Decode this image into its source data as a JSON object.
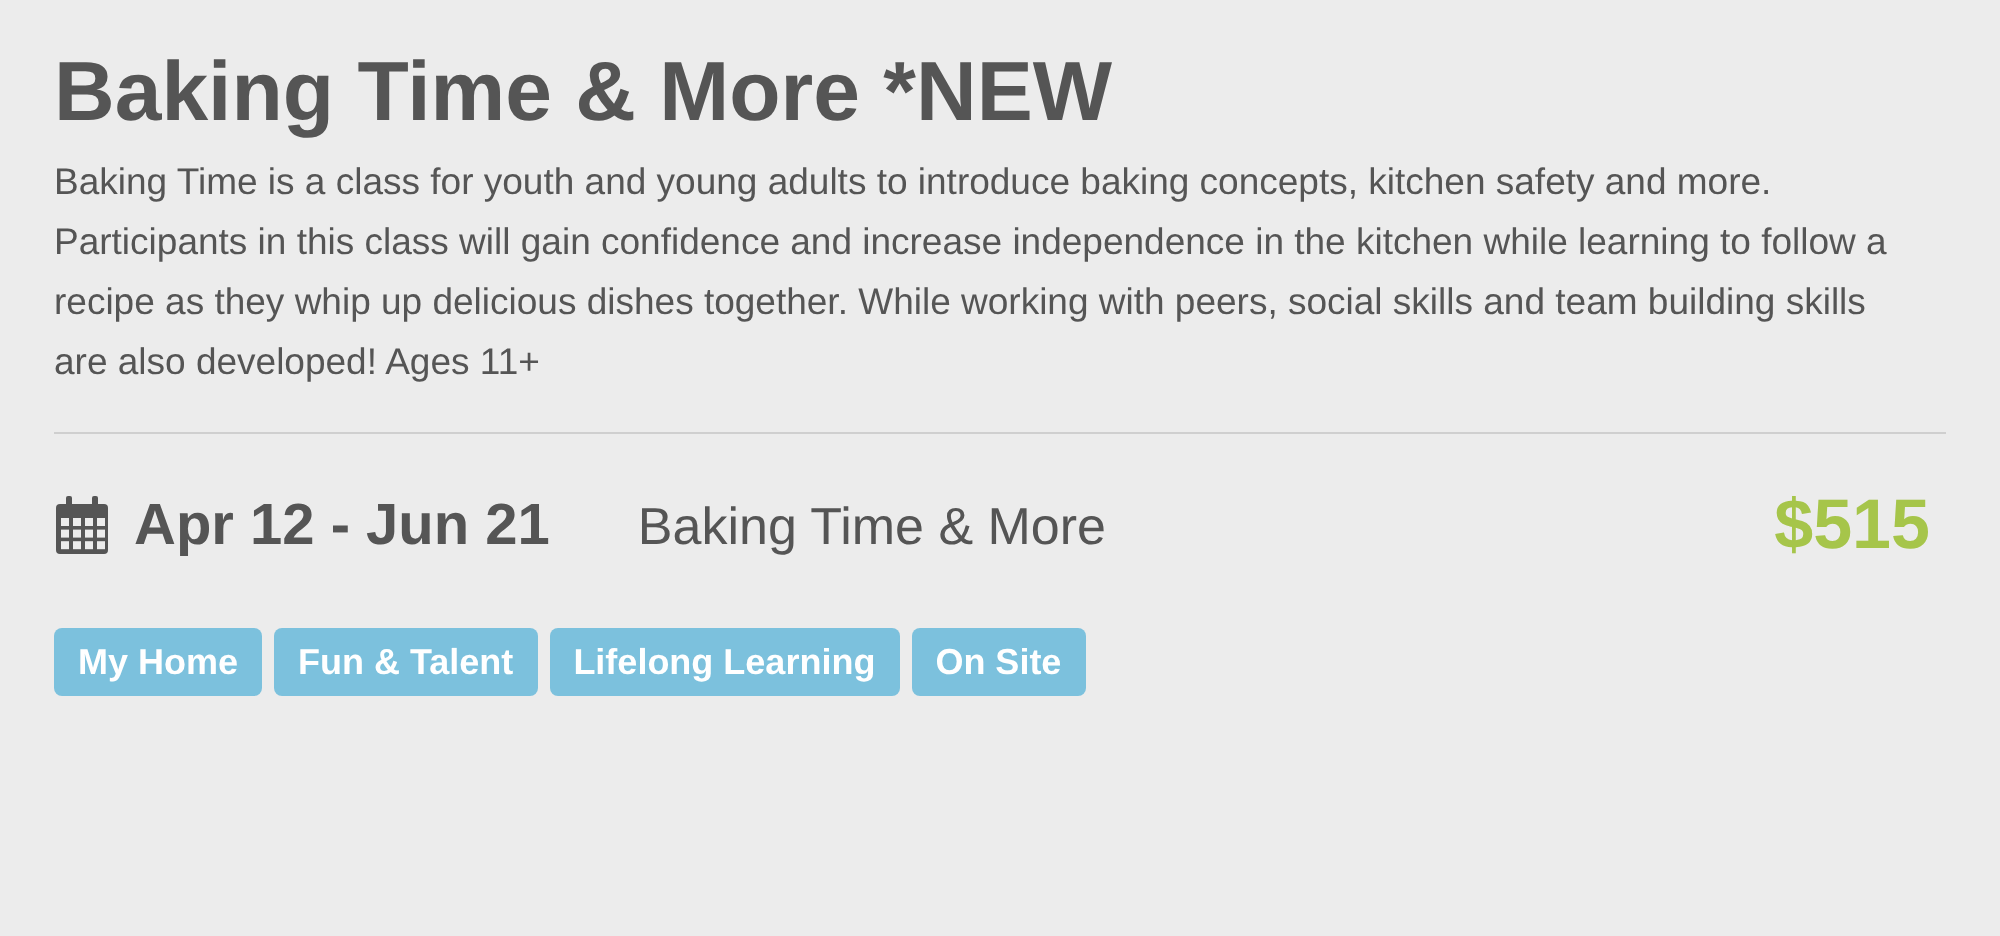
{
  "title": "Baking Time & More *NEW",
  "description": "Baking Time is a class for youth and young adults to introduce baking concepts, kitchen safety and more. Participants in this class will gain confidence and increase independence in the kitchen while learning to follow a recipe as they whip up delicious dishes together. While working with peers, social skills and team building skills are also developed! Ages 11+",
  "session": {
    "dates": "Apr 12 - Jun 21",
    "name": "Baking Time & More",
    "price": "$515"
  },
  "tags": [
    "My Home",
    "Fun & Talent",
    "Lifelong Learning",
    "On Site"
  ]
}
